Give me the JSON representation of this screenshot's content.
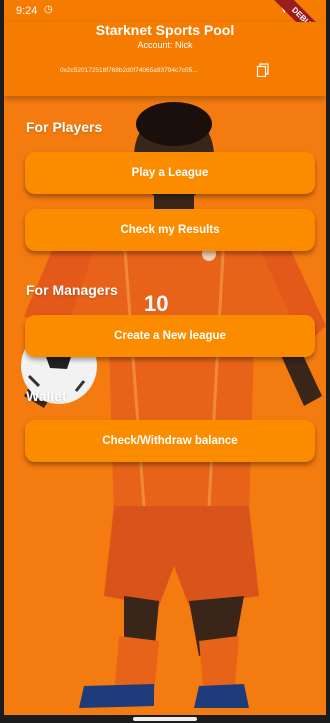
{
  "status_bar": {
    "time": "9:24",
    "debug_label": "DEBUG"
  },
  "app_bar": {
    "title": "Starknet Sports Pool",
    "account": "Account: Nick",
    "address": "0x2c520172518f768b2d0f74065a93794c7c05..."
  },
  "players_section": {
    "heading": "For Players",
    "play_button": "Play a League",
    "results_button": "Check my Results"
  },
  "managers_section": {
    "heading": "For Managers",
    "create_button": "Create a New league"
  },
  "wallet_section": {
    "heading": "Wallet",
    "balance_button": "Check/Withdraw balance"
  },
  "colors": {
    "accent": "#f57c00",
    "button": "#fb8c00",
    "jersey": "#e8631a"
  },
  "icons": {
    "status_extra": "clock-icon",
    "copy": "copy-icon",
    "signal": "wifi-icon"
  }
}
